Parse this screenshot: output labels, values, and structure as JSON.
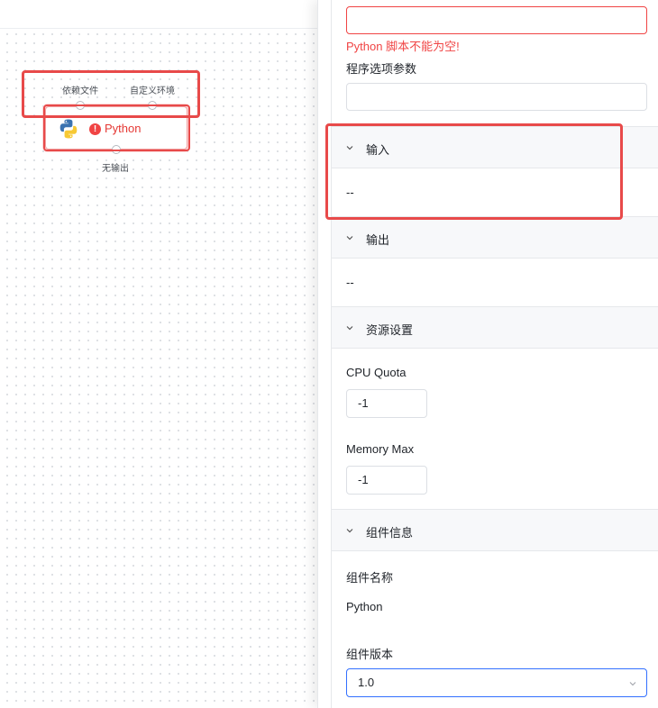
{
  "canvas": {
    "node": {
      "title": "Python",
      "input_ports": [
        "依赖文件",
        "自定义环境"
      ],
      "output_label": "无输出",
      "icon": "python-logo-icon",
      "status_icon": "error-icon"
    }
  },
  "panel": {
    "script_error": "Python 脚本不能为空!",
    "options_label": "程序选项参数",
    "sections": {
      "input": {
        "title": "输入",
        "value": "--"
      },
      "output": {
        "title": "输出",
        "value": "--"
      },
      "resources": {
        "title": "资源设置",
        "cpu_label": "CPU Quota",
        "cpu_value": "-1",
        "memory_label": "Memory Max",
        "memory_value": "-1"
      },
      "component": {
        "title": "组件信息",
        "name_label": "组件名称",
        "name_value": "Python",
        "version_label": "组件版本",
        "version_value": "1.0"
      }
    }
  },
  "colors": {
    "error": "#f04444",
    "highlight": "#e84a4a",
    "accent": "#3370ff"
  }
}
